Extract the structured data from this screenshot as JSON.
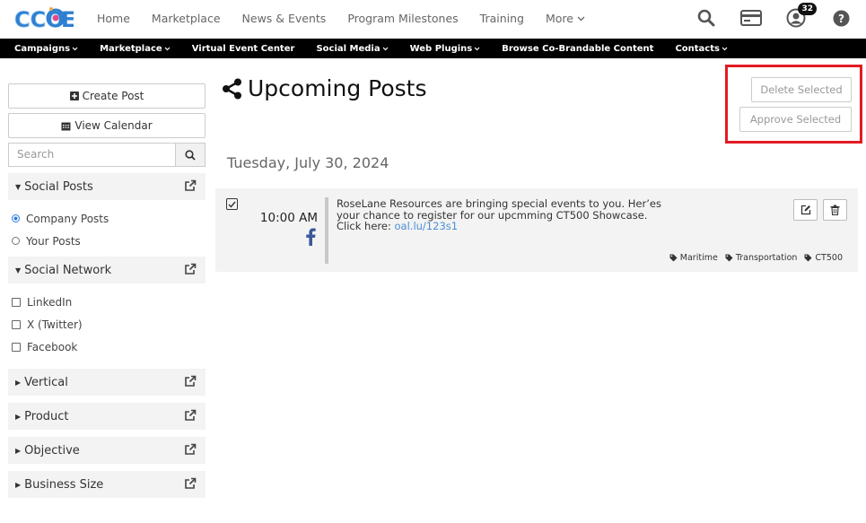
{
  "brand": {
    "name": "CCOE"
  },
  "topnav": {
    "items": [
      "Home",
      "Marketplace",
      "News & Events",
      "Program Milestones",
      "Training"
    ],
    "more_label": "More",
    "notification_count": "32"
  },
  "subnav": {
    "items": [
      "Campaigns",
      "Marketplace",
      "Virtual Event Center",
      "Social Media",
      "Web Plugins",
      "Browse Co-Brandable Content",
      "Contacts"
    ]
  },
  "sidebar": {
    "create_post": "Create Post",
    "view_calendar": "View Calendar",
    "search_placeholder": "Search",
    "social_posts": {
      "label": "Social Posts",
      "options": [
        "Company Posts",
        "Your Posts"
      ],
      "selected": "Company Posts"
    },
    "social_network": {
      "label": "Social Network",
      "options": [
        "LinkedIn",
        "X (Twitter)",
        "Facebook"
      ]
    },
    "filters": [
      "Vertical",
      "Product",
      "Objective",
      "Business Size"
    ]
  },
  "main": {
    "title": "Upcoming Posts",
    "delete_selected": "Delete Selected",
    "approve_selected": "Approve Selected",
    "date_heading": "Tuesday, July 30, 2024",
    "post": {
      "time": "10:00 AM",
      "network": "facebook",
      "line1": "RoseLane Resources are bringing special events to you. Her’es",
      "line2": "your chance to register for our upcmming CT500 Showcase.",
      "line3_prefix": "Click here: ",
      "link": "oal.lu/123s1",
      "tags": [
        "Maritime",
        "Transportation",
        "CT500"
      ]
    }
  },
  "colors": {
    "highlight": "#e21b24",
    "link": "#4a8fd4",
    "facebook": "#3b5998",
    "brand_blue": "#2f7fd1"
  }
}
